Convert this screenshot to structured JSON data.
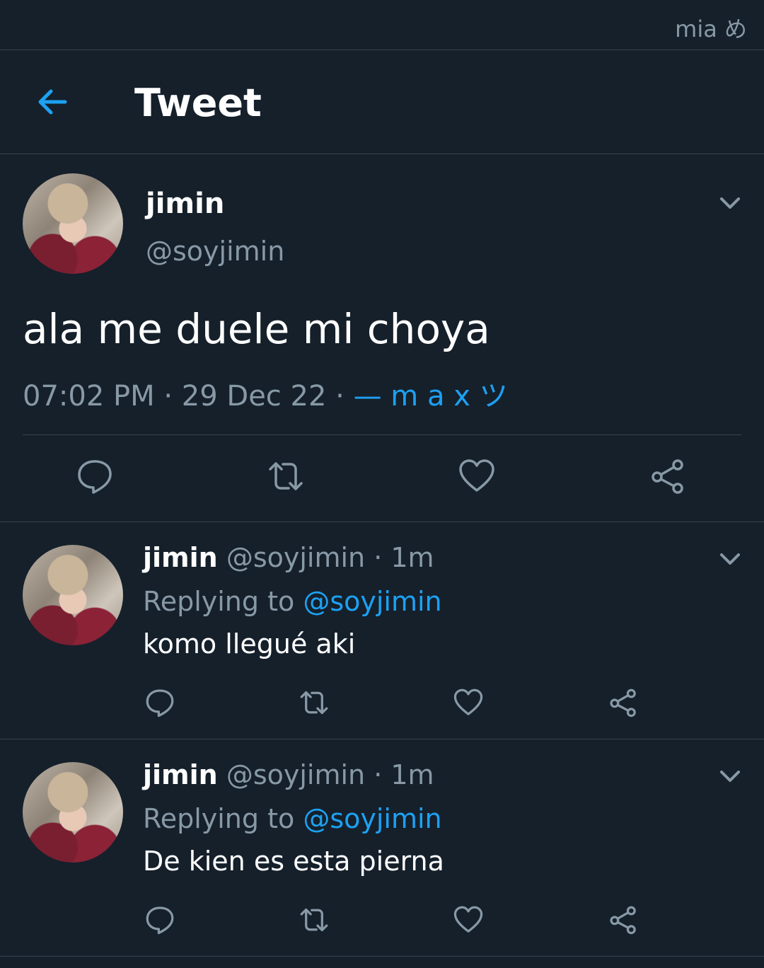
{
  "status_bar": {
    "right_text": "mia め"
  },
  "header": {
    "title": "Tweet"
  },
  "main_tweet": {
    "name": "jimin",
    "handle": "@soyjimin",
    "text": "ala me duele mi choya",
    "time": "07:02 PM",
    "sep1": " · ",
    "date": "29 Dec 22",
    "sep2": " · ",
    "source": "— m a x ツ"
  },
  "replies": [
    {
      "name": "jimin",
      "handle_time": "@soyjimin · 1m",
      "replying_prefix": "Replying to ",
      "replying_to": "@soyjimin",
      "text": "komo llegué aki"
    },
    {
      "name": "jimin",
      "handle_time": "@soyjimin · 1m",
      "replying_prefix": "Replying to ",
      "replying_to": "@soyjimin",
      "text": "De kien es esta pierna"
    }
  ],
  "icons": {
    "back": "arrow-left-icon",
    "more": "chevron-down-icon",
    "reply": "comment-icon",
    "retweet": "retweet-icon",
    "like": "heart-icon",
    "share": "share-icon"
  },
  "colors": {
    "background": "#15202b",
    "divider": "#38444d",
    "secondary_text": "#8899a6",
    "accent": "#1da1f2"
  }
}
